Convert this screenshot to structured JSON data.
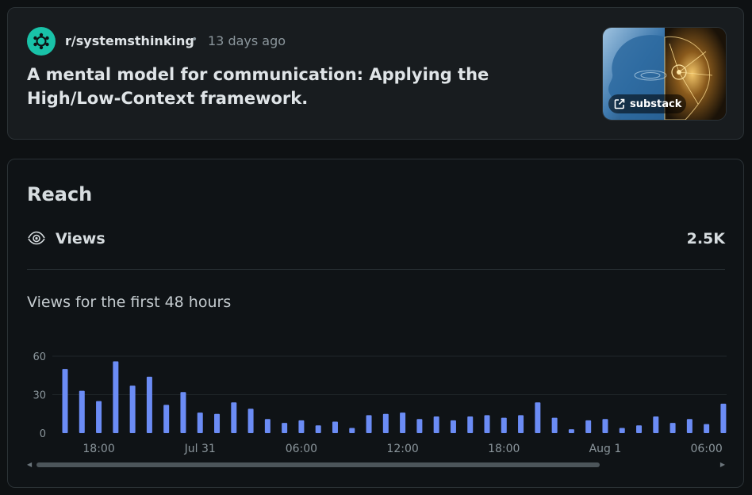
{
  "post": {
    "subreddit": "r/systemsthinking",
    "separator": "•",
    "time_ago": "13 days ago",
    "title": "A mental model for communication: Applying the High/Low-Context framework.",
    "thumbnail_link_label": "substack"
  },
  "reach": {
    "title": "Reach",
    "views_label": "Views",
    "views_value": "2.5K",
    "chart_caption": "Views for the first 48 hours"
  },
  "colors": {
    "bar": "#6b8cf5",
    "card_bg": "#181c1f",
    "page_bg": "#0e1113",
    "subreddit_icon": "#19c2a8"
  },
  "icons": [
    "subreddit-icon",
    "external-link-icon",
    "eye-icon",
    "scroll-left-icon",
    "scroll-right-icon"
  ],
  "chart_data": {
    "type": "bar",
    "title": "Views for the first 48 hours",
    "xlabel": "",
    "ylabel": "",
    "ylim": [
      0,
      60
    ],
    "yticks": [
      "0",
      "30",
      "60"
    ],
    "x_tick_labels": [
      "18:00",
      "Jul 31",
      "06:00",
      "12:00",
      "18:00",
      "Aug 1",
      "06:00"
    ],
    "x_tick_bar_index": [
      2,
      8,
      14,
      20,
      26,
      32,
      38
    ],
    "grid": true,
    "series": [
      {
        "values": [
          50,
          33,
          25,
          56,
          37,
          44,
          22,
          32,
          16,
          15,
          24,
          19,
          11,
          8,
          10,
          6,
          9,
          4,
          14,
          15,
          16,
          11,
          13,
          10,
          13,
          14,
          12,
          14,
          24,
          12,
          3,
          10,
          11,
          4,
          6,
          13,
          8,
          11,
          7,
          23
        ]
      }
    ]
  }
}
